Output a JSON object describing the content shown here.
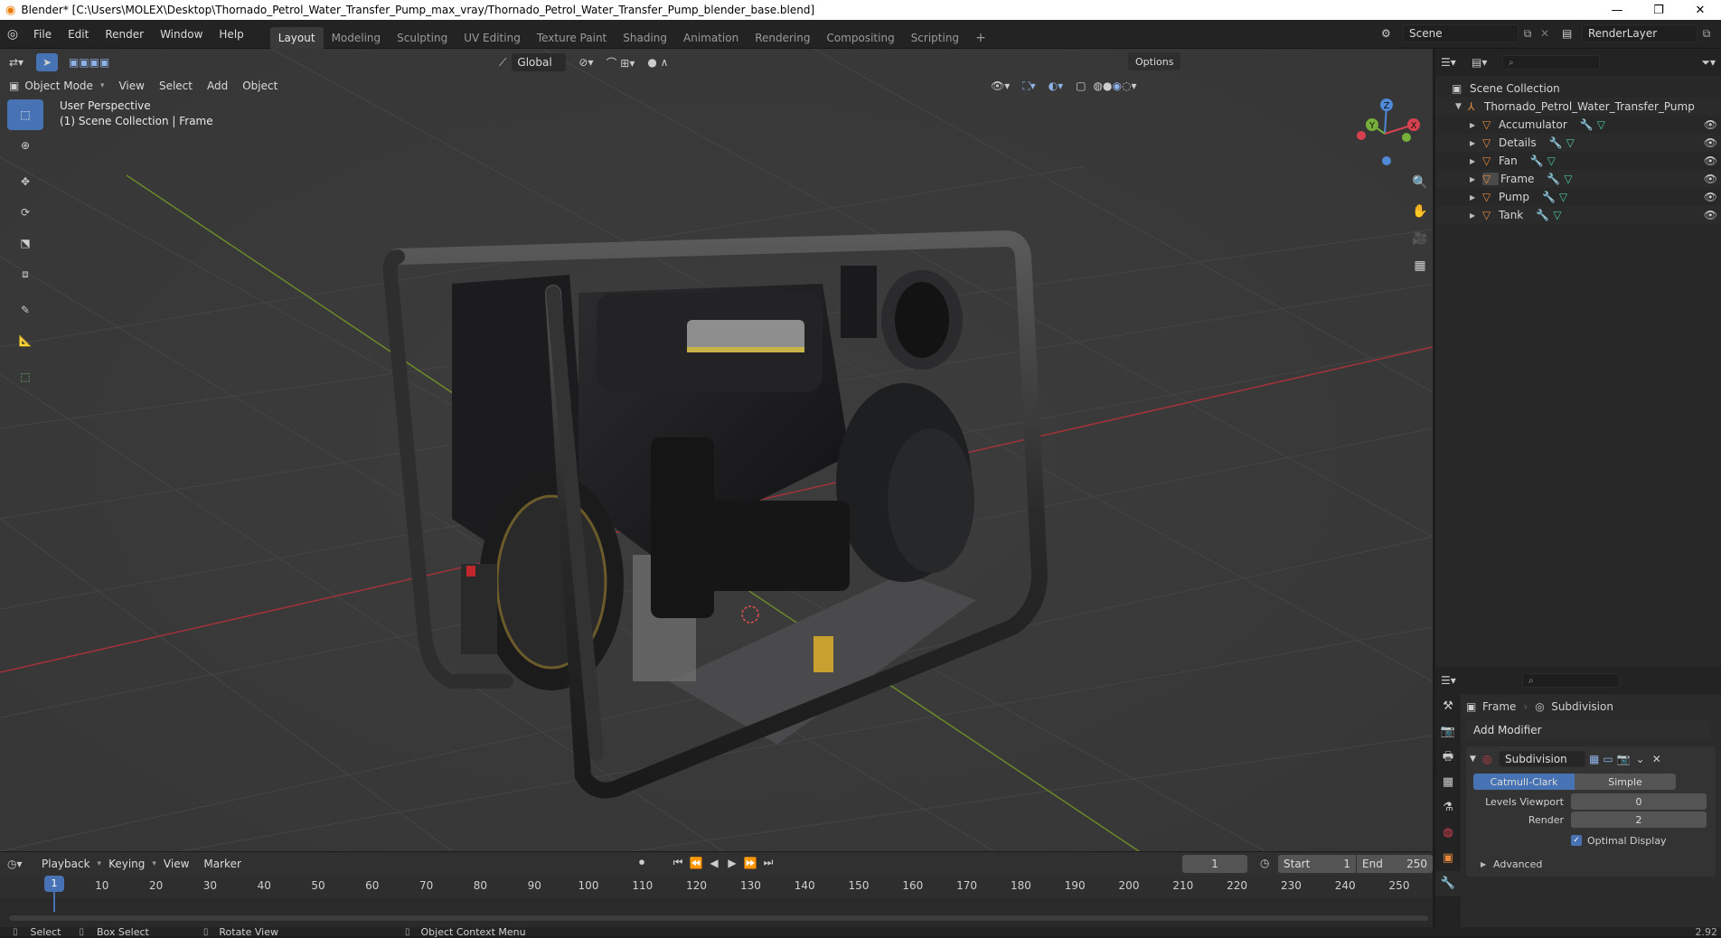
{
  "window": {
    "title": "Blender* [C:\\Users\\MOLEX\\Desktop\\Thornado_Petrol_Water_Transfer_Pump_max_vray/Thornado_Petrol_Water_Transfer_Pump_blender_base.blend]",
    "minimize": "—",
    "maximize": "❐",
    "close": "✕"
  },
  "menu": [
    "File",
    "Edit",
    "Render",
    "Window",
    "Help"
  ],
  "workspaces": [
    "Layout",
    "Modeling",
    "Sculpting",
    "UV Editing",
    "Texture Paint",
    "Shading",
    "Animation",
    "Rendering",
    "Compositing",
    "Scripting"
  ],
  "active_workspace": "Layout",
  "scene": {
    "name": "Scene",
    "render_layer": "RenderLayer"
  },
  "viewport_header": {
    "transform_orientation": "Global",
    "options": "Options",
    "mode": "Object Mode",
    "menus": [
      "View",
      "Select",
      "Add",
      "Object"
    ]
  },
  "viewport": {
    "perspective": "User Perspective",
    "collection_info": "(1) Scene Collection | Frame",
    "gizmo": {
      "z": "Z",
      "y": "Y",
      "x": "X"
    }
  },
  "outliner": {
    "root": "Scene Collection",
    "collection": "Thornado_Petrol_Water_Transfer_Pump",
    "objects": [
      "Accumulator",
      "Details",
      "Fan",
      "Frame",
      "Pump",
      "Tank"
    ],
    "selected": "Frame"
  },
  "properties": {
    "object": "Frame",
    "modifier_context": "Subdivision",
    "add_modifier": "Add Modifier",
    "modifier_name": "Subdivision",
    "type_catmull": "Catmull-Clark",
    "type_simple": "Simple",
    "levels_viewport_label": "Levels Viewport",
    "levels_viewport_value": "0",
    "render_label": "Render",
    "render_value": "2",
    "optimal_display": "Optimal Display",
    "advanced": "Advanced"
  },
  "timeline": {
    "menus": [
      "Playback",
      "Keying",
      "View",
      "Marker"
    ],
    "current_frame": "1",
    "start_label": "Start",
    "start_value": "1",
    "end_label": "End",
    "end_value": "250",
    "ticks": [
      "1",
      "10",
      "20",
      "30",
      "40",
      "50",
      "60",
      "70",
      "80",
      "90",
      "100",
      "110",
      "120",
      "130",
      "140",
      "150",
      "160",
      "170",
      "180",
      "190",
      "200",
      "210",
      "220",
      "230",
      "240",
      "250"
    ]
  },
  "statusbar": {
    "select": "Select",
    "box_select": "Box Select",
    "rotate_view": "Rotate View",
    "context_menu": "Object Context Menu",
    "version": "2.92"
  },
  "colors": {
    "accent": "#4772b3",
    "x_axis": "#d8414f",
    "y_axis": "#76b03a",
    "z_axis": "#4f89d8",
    "object_icon": "#e78a3c"
  }
}
